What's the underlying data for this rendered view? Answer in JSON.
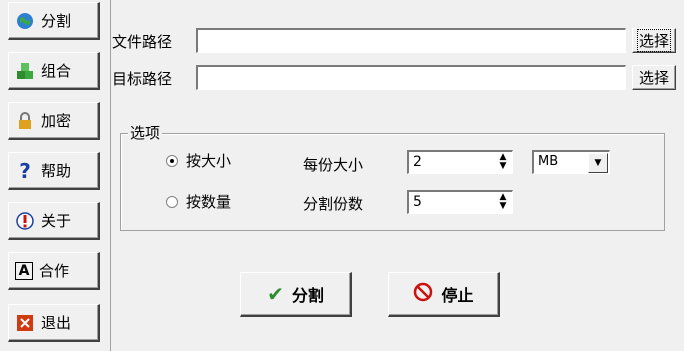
{
  "sidebar": {
    "items": [
      {
        "label": "分割",
        "icon": "globe-icon"
      },
      {
        "label": "组合",
        "icon": "blocks-icon"
      },
      {
        "label": "加密",
        "icon": "lock-icon"
      },
      {
        "label": "帮助",
        "icon": "help-icon"
      },
      {
        "label": "关于",
        "icon": "alert-icon"
      },
      {
        "label": "合作",
        "icon": "letter-a-icon"
      },
      {
        "label": "退出",
        "icon": "exit-icon"
      }
    ]
  },
  "form": {
    "file_path_label": "文件路径",
    "file_path_value": "",
    "target_path_label": "目标路径",
    "target_path_value": "",
    "browse_label": "选择"
  },
  "options": {
    "legend": "选项",
    "by_size_label": "按大小",
    "by_count_label": "按数量",
    "size_each_label": "每份大小",
    "split_count_label": "分割份数",
    "size_value": "2",
    "unit_value": "MB",
    "count_value": "5",
    "selected_mode": "by_size"
  },
  "actions": {
    "split_label": "分割",
    "stop_label": "停止"
  },
  "colors": {
    "check": "#2e8b2e",
    "stop": "#cc1010",
    "help": "#1a3fa0"
  }
}
